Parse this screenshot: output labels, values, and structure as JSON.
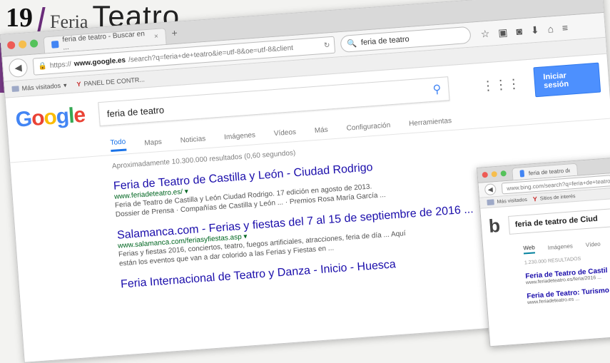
{
  "brand": {
    "number": "19",
    "feria": "Feria",
    "teatro": "Teatro"
  },
  "main_window": {
    "tab_title": "feria de teatro - Buscar en ...",
    "tab_close": "×",
    "new_tab": "+",
    "url_protocol": "https://",
    "url_host": "www.google.es",
    "url_path": "/search?q=feria+de+teatro&ie=utf-8&oe=utf-8&client",
    "search_bar_value": "feria de teatro",
    "bookmarks": {
      "most_visited": "Más visitados",
      "panel": "PANEL DE CONTR..."
    },
    "google": {
      "logo": [
        "G",
        "o",
        "o",
        "g",
        "l",
        "e"
      ],
      "query": "feria de teatro",
      "signin_label": "Iniciar sesión",
      "tabs": [
        "Todo",
        "Maps",
        "Noticias",
        "Imágenes",
        "Vídeos",
        "Más",
        "Configuración",
        "Herramientas"
      ],
      "stats": "Aproximadamente 10.300.000 resultados (0,60 segundos)",
      "results": [
        {
          "title": "Feria de Teatro de Castilla y León - Ciudad Rodrigo",
          "url": "www.feriadeteatro.es/ ▾",
          "snippet": "Feria de Teatro de Castilla y León Ciudad Rodrigo. 17 edición en agosto de 2013.",
          "snippet2": "Dossier de Prensa · Compañías de Castilla y León ... · Premios Rosa María García ..."
        },
        {
          "title": "Salamanca.com - Ferias y fiestas del 7 al 15 de septiembre de 2016 ...",
          "url": "www.salamanca.com/feriasyfiestas.asp ▾",
          "snippet": "Ferias y fiestas 2016, conciertos, teatro, fuegos artificiales, atracciones, feria de día ... Aquí",
          "snippet2": "están los eventos que van a dar colorido a las Ferias y Fiestas en ..."
        },
        {
          "title": "Feria Internacional de Teatro y Danza - Inicio - Huesca",
          "url": "",
          "snippet": "",
          "snippet2": ""
        }
      ]
    }
  },
  "bing_window": {
    "tab_title": "feria de teatro de Ciudad...",
    "url": "www.bing.com/search?q=feria+de+teatro",
    "bookmarks": {
      "most_visited": "Más visitados",
      "panel": "Sitios de interés"
    },
    "logo": "b",
    "query": "feria de teatro de Ciud",
    "tabs": [
      "Web",
      "Imágenes",
      "Vídeo"
    ],
    "stats": "1.230.000 RESULTADOS",
    "results": [
      {
        "title": "Feria de Teatro de Castil",
        "snippet": "www.feriadeteatro.es/feria/2016 ..."
      },
      {
        "title": "Feria de Teatro: Turismo",
        "snippet": "www.feriadeteatro.es ..."
      }
    ]
  }
}
